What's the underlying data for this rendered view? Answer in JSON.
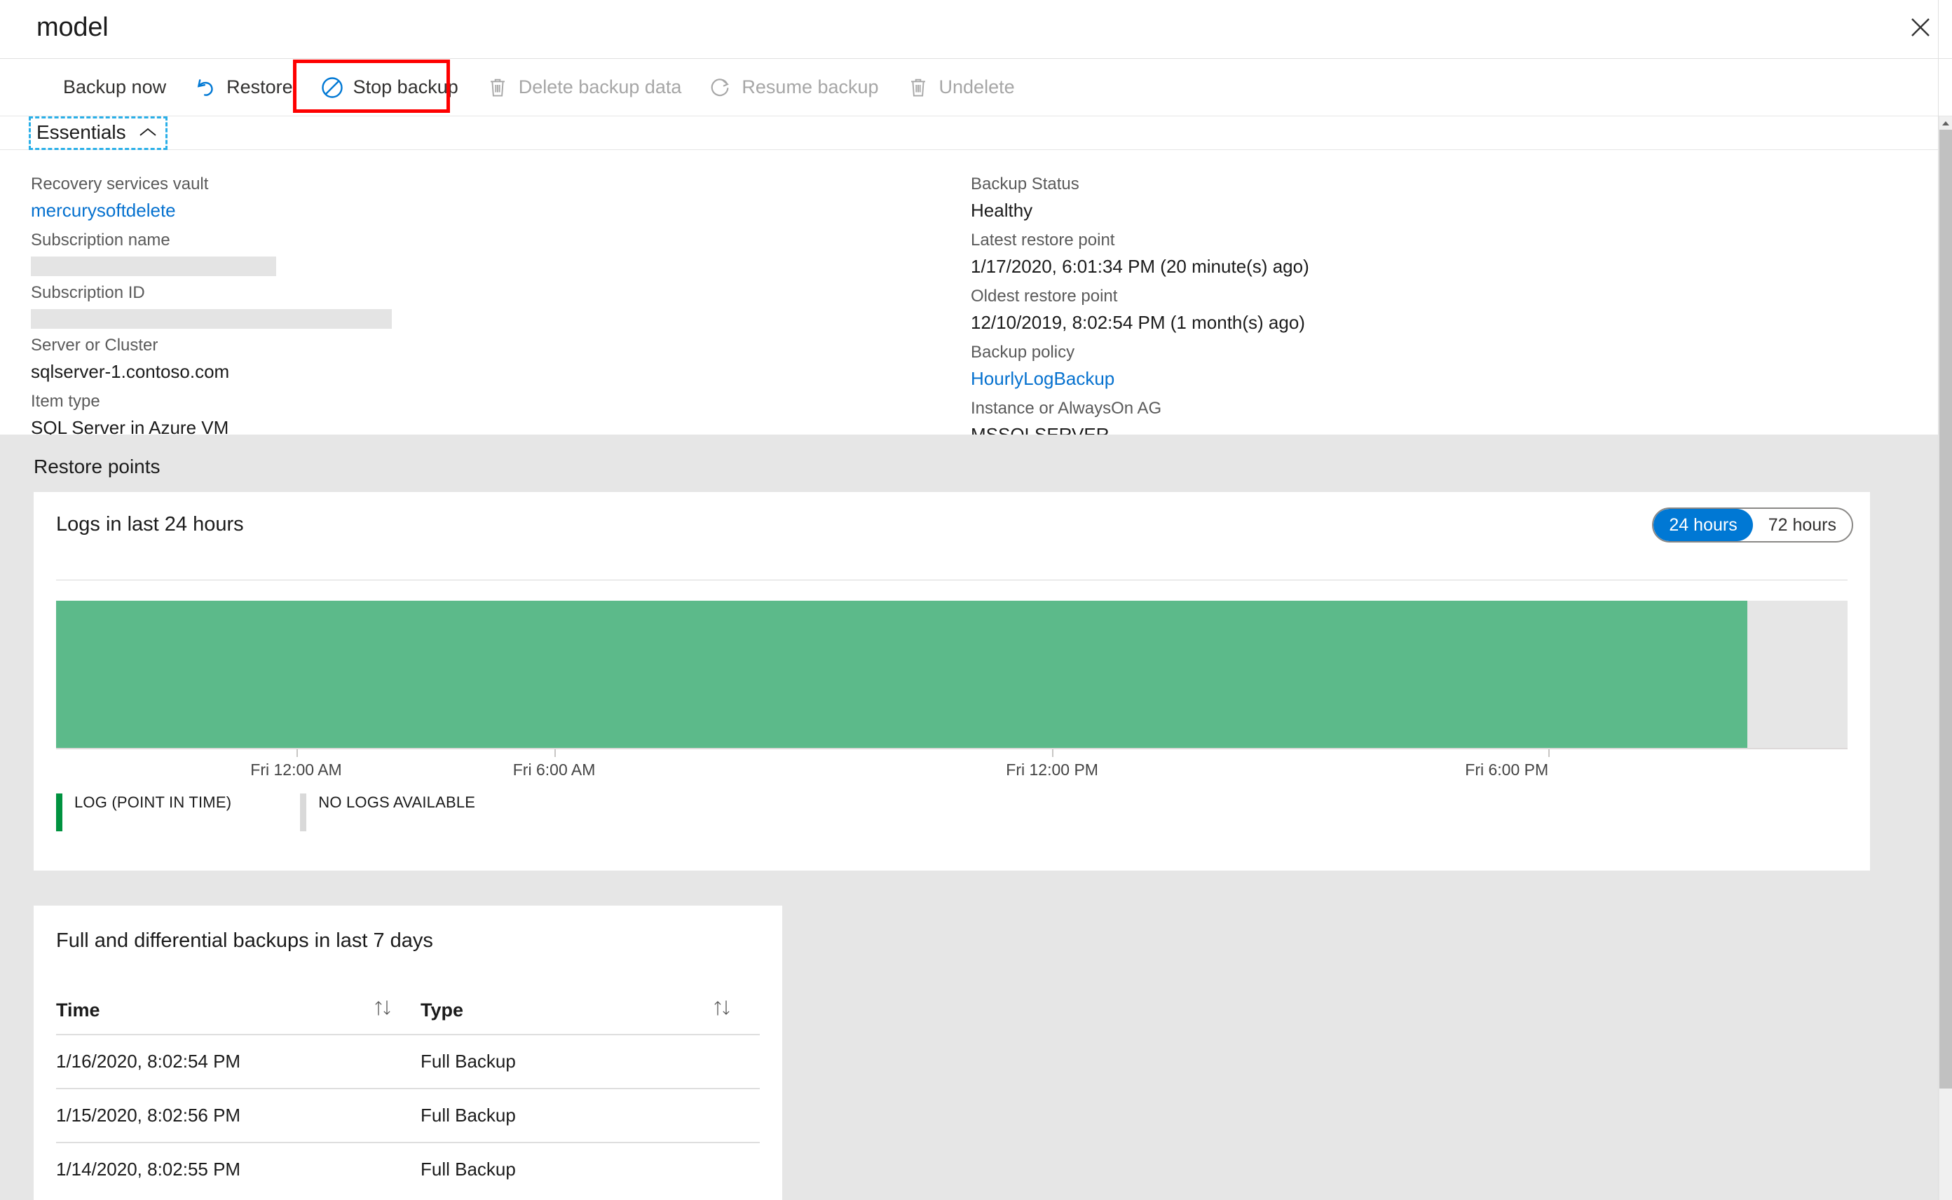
{
  "window": {
    "title": "model",
    "close_icon": "close-icon"
  },
  "toolbar": {
    "items": [
      {
        "label": "Backup now",
        "icon": "backup-now-icon",
        "enabled": true,
        "highlighted": false
      },
      {
        "label": "Restore",
        "icon": "restore-undo-icon",
        "enabled": true,
        "highlighted": false
      },
      {
        "label": "Stop backup",
        "icon": "stop-circle-slash-icon",
        "enabled": true,
        "highlighted": true
      },
      {
        "label": "Delete backup data",
        "icon": "trash-icon",
        "enabled": false,
        "highlighted": false
      },
      {
        "label": "Resume backup",
        "icon": "refresh-circle-icon",
        "enabled": false,
        "highlighted": false
      },
      {
        "label": "Undelete",
        "icon": "trash-icon",
        "enabled": false,
        "highlighted": false
      }
    ],
    "highlight_color": "#fe0000"
  },
  "essentials": {
    "header_label": "Essentials",
    "chevron_icon": "chevron-up-icon",
    "expanded": true,
    "left_fields": [
      {
        "label": "Recovery services vault",
        "value": "mercurysoftdelete",
        "type": "link"
      },
      {
        "label": "Subscription name",
        "value": "",
        "type": "redacted",
        "redact_width": "w1"
      },
      {
        "label": "Subscription ID",
        "value": "",
        "type": "redacted",
        "redact_width": "w2"
      },
      {
        "label": "Server or Cluster",
        "value": "sqlserver-1.contoso.com",
        "type": "text"
      },
      {
        "label": "Item type",
        "value": "SQL Server in Azure VM",
        "type": "text"
      }
    ],
    "right_fields": [
      {
        "label": "Backup Status",
        "value": "Healthy",
        "type": "text"
      },
      {
        "label": "Latest restore point",
        "value": "1/17/2020, 6:01:34 PM (20 minute(s) ago)",
        "type": "text"
      },
      {
        "label": "Oldest restore point",
        "value": "12/10/2019, 8:02:54 PM (1 month(s) ago)",
        "type": "text"
      },
      {
        "label": "Backup policy",
        "value": "HourlyLogBackup",
        "type": "link"
      },
      {
        "label": "Instance or AlwaysOn AG",
        "value": "MSSQLSERVER",
        "type": "text"
      }
    ]
  },
  "restore_points": {
    "section_title": "Restore points",
    "logs_card": {
      "title": "Logs in last 24 hours",
      "range_toggle": {
        "options": [
          "24 hours",
          "72 hours"
        ],
        "selected": "24 hours",
        "selected_color": "#0078d4"
      },
      "legend": [
        {
          "label": "LOG (POINT IN TIME)",
          "color": "#00923f",
          "swatch": "green-swatch-icon"
        },
        {
          "label": "NO LOGS AVAILABLE",
          "color": "#d9d9d9",
          "swatch": "gray-swatch-icon"
        }
      ]
    },
    "table_card": {
      "title": "Full and differential backups in last 7 days",
      "columns": [
        {
          "label": "Time",
          "sort_icon": "sort-updown-icon"
        },
        {
          "label": "Type",
          "sort_icon": "sort-updown-icon"
        }
      ],
      "rows": [
        {
          "time": "1/16/2020, 8:02:54 PM",
          "type": "Full Backup"
        },
        {
          "time": "1/15/2020, 8:02:56 PM",
          "type": "Full Backup"
        },
        {
          "time": "1/14/2020, 8:02:55 PM",
          "type": "Full Backup"
        }
      ]
    }
  },
  "chart_data": {
    "type": "bar",
    "title": "Logs in last 24 hours",
    "xlabel": "",
    "ylabel": "",
    "grid": false,
    "legend_position": "bottom-left",
    "axis_ticks": [
      "Fri 12:00 AM",
      "Fri 6:00 AM",
      "Fri 12:00 PM",
      "Fri 6:00 PM"
    ],
    "tick_positions_pct": [
      13.4,
      27.8,
      55.6,
      83.3
    ],
    "series": [
      {
        "name": "LOG (POINT IN TIME)",
        "color": "#5cba8a",
        "span_pct": 94.4
      },
      {
        "name": "NO LOGS AVAILABLE",
        "color": "#e6e6e6",
        "span_pct": 5.6
      }
    ],
    "categories": [
      "Fri 12:00 AM",
      "Fri 6:00 AM",
      "Fri 12:00 PM",
      "Fri 6:00 PM"
    ],
    "values": [
      1,
      1,
      1,
      1
    ]
  },
  "scrollbar": {
    "up_arrow_icon": "chevron-up-icon"
  }
}
